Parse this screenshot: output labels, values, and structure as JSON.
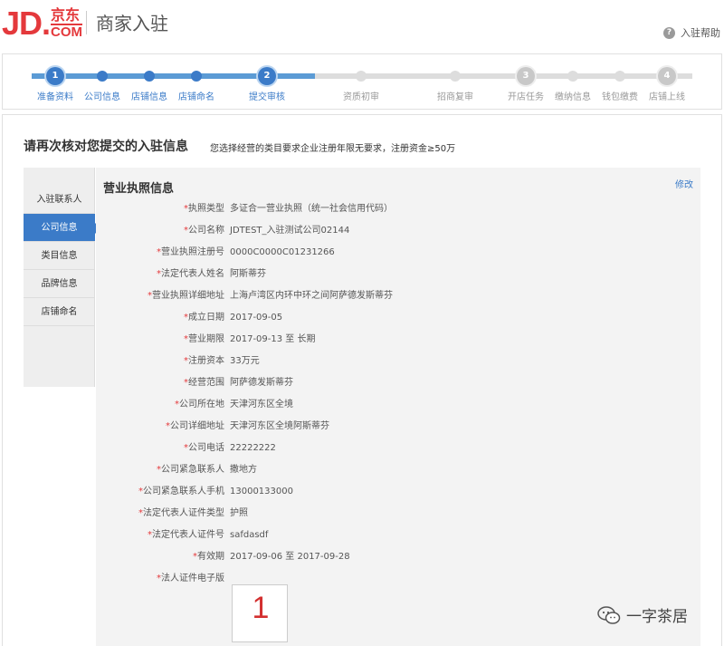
{
  "header": {
    "logo_jd": "JD.",
    "logo_cn": "京东",
    "logo_com": "COM",
    "title": "商家入驻",
    "help_label": "入驻帮助",
    "help_icon": "question-circle-icon"
  },
  "progress": {
    "steps": [
      {
        "label": "准备资料",
        "state": "done",
        "number": "1"
      },
      {
        "label": "公司信息",
        "state": "done",
        "number": ""
      },
      {
        "label": "店铺信息",
        "state": "done",
        "number": ""
      },
      {
        "label": "店铺命名",
        "state": "done",
        "number": ""
      },
      {
        "label": "提交审核",
        "state": "done",
        "number": "2"
      },
      {
        "label": "资质初审",
        "state": "todo",
        "number": ""
      },
      {
        "label": "招商复审",
        "state": "todo",
        "number": ""
      },
      {
        "label": "开店任务",
        "state": "todo",
        "number": "3"
      },
      {
        "label": "缴纳信息",
        "state": "todo",
        "number": ""
      },
      {
        "label": "钱包缴费",
        "state": "todo",
        "number": ""
      },
      {
        "label": "店铺上线",
        "state": "todo",
        "number": "4"
      }
    ]
  },
  "review": {
    "title": "请再次核对您提交的入驻信息",
    "note": "您选择经营的类目要求企业注册年限无要求，注册资金≥50万"
  },
  "sidebar": {
    "items": [
      {
        "label": "入驻联系人",
        "active": false
      },
      {
        "label": "公司信息",
        "active": true
      },
      {
        "label": "类目信息",
        "active": false
      },
      {
        "label": "品牌信息",
        "active": false
      },
      {
        "label": "店铺命名",
        "active": false
      }
    ]
  },
  "license": {
    "section_title": "营业执照信息",
    "edit_label": "修改",
    "fields": [
      {
        "label": "执照类型",
        "value": "多证合一营业执照（统一社会信用代码）"
      },
      {
        "label": "公司名称",
        "value": "JDTEST_入驻测试公司02144"
      },
      {
        "label": "营业执照注册号",
        "value": "0000C0000C01231266"
      },
      {
        "label": "法定代表人姓名",
        "value": "阿斯蒂芬"
      },
      {
        "label": "营业执照详细地址",
        "value": "上海卢湾区内环中环之间阿萨德发斯蒂芬"
      },
      {
        "label": "成立日期",
        "value": "2017-09-05"
      },
      {
        "label": "营业期限",
        "value": "2017-09-13 至 长期"
      },
      {
        "label": "注册资本",
        "value": "33万元"
      },
      {
        "label": "经营范围",
        "value": "阿萨德发斯蒂芬"
      },
      {
        "label": "公司所在地",
        "value": "天津河东区全境"
      },
      {
        "label": "公司详细地址",
        "value": "天津河东区全境阿斯蒂芬"
      },
      {
        "label": "公司电话",
        "value": "22222222"
      },
      {
        "label": "公司紧急联系人",
        "value": "撒地方"
      },
      {
        "label": "公司紧急联系人手机",
        "value": "13000133000"
      },
      {
        "label": "法定代表人证件类型",
        "value": "护照"
      },
      {
        "label": "法定代表人证件号",
        "value": "safdasdf"
      },
      {
        "label": "有效期",
        "value": "2017-09-06 至 2017-09-28"
      },
      {
        "label": "法人证件电子版",
        "value": ""
      }
    ],
    "cert_thumb_number": "1"
  },
  "watermark": {
    "text": "一字茶居",
    "icon": "wechat-icon"
  },
  "colors": {
    "brand_red": "#e4393c",
    "accent_blue": "#3b7bc8"
  }
}
